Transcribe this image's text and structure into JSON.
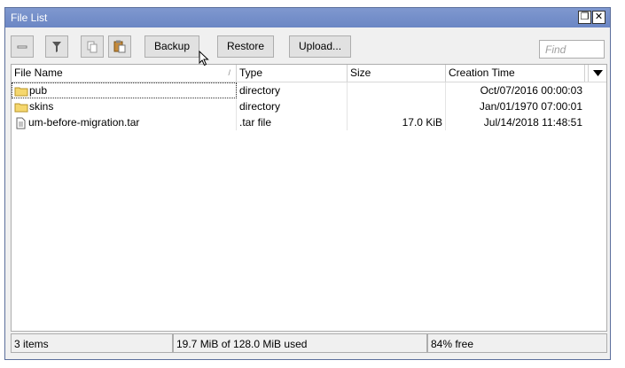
{
  "window": {
    "title": "File List",
    "restore_glyph": "❐",
    "close_glyph": "✕"
  },
  "toolbar": {
    "backup_label": "Backup",
    "restore_label": "Restore",
    "upload_label": "Upload...",
    "find_placeholder": "Find",
    "icons": [
      "minus-icon",
      "filter-icon",
      "copy-icon",
      "paste-icon"
    ]
  },
  "table": {
    "columns": [
      "File Name",
      "Type",
      "Size",
      "Creation Time"
    ],
    "sort_indicator": "/",
    "rows": [
      {
        "icon": "folder-icon",
        "name": "pub",
        "type": "directory",
        "size": "",
        "created": "Oct/07/2016 00:00:03"
      },
      {
        "icon": "folder-icon",
        "name": "skins",
        "type": "directory",
        "size": "",
        "created": "Jan/01/1970 07:00:01"
      },
      {
        "icon": "file-icon",
        "name": "um-before-migration.tar",
        "type": ".tar file",
        "size": "17.0 KiB",
        "created": "Jul/14/2018 11:48:51"
      }
    ]
  },
  "status": {
    "items": "3 items",
    "usage": "19.7 MiB of 128.0 MiB used",
    "free": "84% free"
  },
  "colors": {
    "titlebar": "#7f98cf",
    "folder": "#f5d76e"
  }
}
